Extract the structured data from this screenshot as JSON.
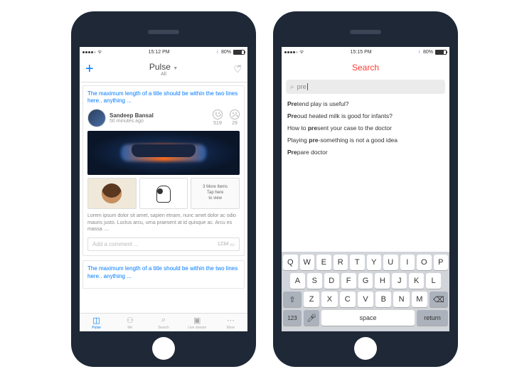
{
  "status": {
    "carrier_dots": 5,
    "filled": 4,
    "time_left": "15:12 PM",
    "time_right": "15:15 PM",
    "bt": "",
    "battery_pct": "80%"
  },
  "pulse": {
    "title": "Pulse",
    "subtitle": "All",
    "card": {
      "title": "The maximum length of a title should be within the two lines here.. anything ...",
      "author": "Sandeep Bansal",
      "time": "50 minutes ago",
      "happy": 519,
      "sad": 29,
      "more_thumb": "3 More Items\nTap here\nto view",
      "body": "Lorem ipsum dolor sit amet, sapien etnam, nunc amet dolor ac odio mauris justo. Luctus arcu, urna praesent at id quisque ac. Arcu es massa ....",
      "comment_ph": "Add a comment ...",
      "comment_count": "1234"
    },
    "card2_title": "The maximum length of a title should be within the two lines here.. anything ...",
    "tabs": [
      {
        "id": "pulse",
        "label": "Pulse",
        "icon": "◫"
      },
      {
        "id": "me",
        "label": "Me",
        "icon": "⚇"
      },
      {
        "id": "search",
        "label": "Search",
        "icon": "⌕"
      },
      {
        "id": "live",
        "label": "Live stream",
        "icon": "▣"
      },
      {
        "id": "more",
        "label": "More",
        "icon": "⋯"
      }
    ]
  },
  "search": {
    "title": "Search",
    "query": "pre",
    "sugs": [
      {
        "pre": "Pre",
        "rest": "tend play is useful?"
      },
      {
        "pre": "Pre",
        "rest": "oud heated milk is good for infants?"
      },
      {
        "plain_a": "How to ",
        "pre": "pre",
        "rest": "sent your case to the doctor"
      },
      {
        "plain_a": "Playing ",
        "pre": "pre",
        "rest": "-something is not a good idea"
      },
      {
        "pre": "Pre",
        "rest": "pare doctor"
      }
    ]
  },
  "kbd": {
    "r1": [
      "Q",
      "W",
      "E",
      "R",
      "T",
      "Y",
      "U",
      "I",
      "O",
      "P"
    ],
    "r2": [
      "A",
      "S",
      "D",
      "F",
      "G",
      "H",
      "J",
      "K",
      "L"
    ],
    "r3": [
      "Z",
      "X",
      "C",
      "V",
      "B",
      "N",
      "M"
    ],
    "num": "123",
    "space": "space",
    "ret": "return"
  }
}
